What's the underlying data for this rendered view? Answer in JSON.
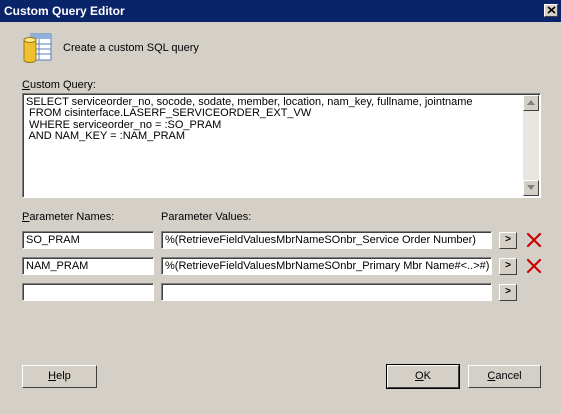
{
  "window": {
    "title": "Custom Query Editor"
  },
  "header": {
    "text": "Create a custom SQL query"
  },
  "query": {
    "label_hotkey": "C",
    "label_rest": "ustom Query:",
    "text": "SELECT serviceorder_no, socode, sodate, member, location, nam_key, fullname, jointname\n FROM cisinterface.LASERF_SERVICEORDER_EXT_VW\n WHERE serviceorder_no = :SO_PRAM\n AND NAM_KEY = :NAM_PRAM"
  },
  "params": {
    "names_label_hotkey": "P",
    "names_label_rest": "arameter Names:",
    "values_label": "Parameter Values:",
    "rows": [
      {
        "name": "SO_PRAM",
        "value": "%(RetrieveFieldValuesMbrNameSOnbr_Service Order Number)",
        "browse": ">"
      },
      {
        "name": "NAM_PRAM",
        "value": "%(RetrieveFieldValuesMbrNameSOnbr_Primary Mbr Name#<..>#)",
        "browse": ">"
      },
      {
        "name": "",
        "value": "",
        "browse": ">"
      }
    ]
  },
  "buttons": {
    "help_hotkey": "H",
    "help_rest": "elp",
    "ok_hotkey": "O",
    "ok_rest": "K",
    "cancel_hotkey": "C",
    "cancel_rest": "ancel"
  },
  "colors": {
    "titlebar": "#0a246a",
    "delete": "#cc0000",
    "dialog": "#d4d0c8"
  }
}
